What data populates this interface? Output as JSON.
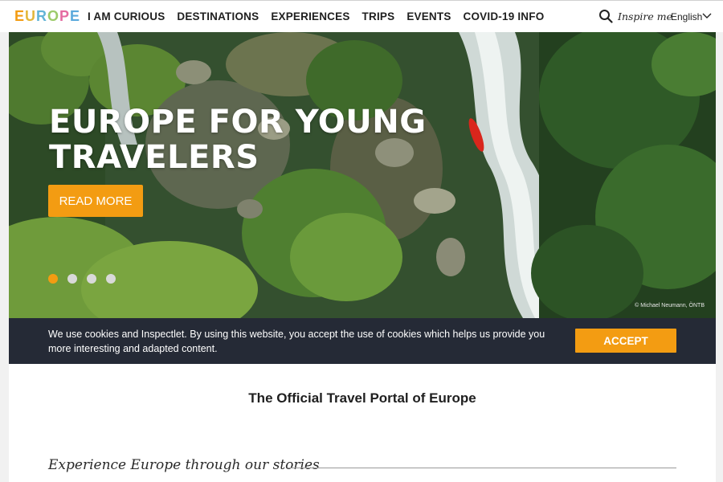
{
  "header": {
    "logo_letters": [
      {
        "char": "E",
        "color": "#f39c12"
      },
      {
        "char": "U",
        "color": "#e3b73b"
      },
      {
        "char": "R",
        "color": "#62b4d6"
      },
      {
        "char": "O",
        "color": "#9ccb6a"
      },
      {
        "char": "P",
        "color": "#e46aa0"
      },
      {
        "char": "E",
        "color": "#5aa9dc"
      }
    ],
    "nav": [
      "I AM CURIOUS",
      "DESTINATIONS",
      "EXPERIENCES",
      "TRIPS",
      "EVENTS",
      "COVID-19 INFO"
    ],
    "inspire_label": "Inspire me",
    "language": "English"
  },
  "hero": {
    "title": "EUROPE FOR YOUNG TRAVELERS",
    "button_label": "READ MORE",
    "slides": 4,
    "active_slide": 1,
    "credit": "© Michael Neumann, ÖNTB"
  },
  "cookie": {
    "text": "We use cookies and Inspectlet. By using this website, you accept the use of cookies which helps us provide you more interesting and adapted content.",
    "button_label": "ACCEPT"
  },
  "main": {
    "portal_title": "The Official Travel Portal of Europe",
    "stories_heading": "Experience Europe through our stories"
  },
  "colors": {
    "accent": "#f39c12",
    "cookie_bg": "#252a36"
  }
}
